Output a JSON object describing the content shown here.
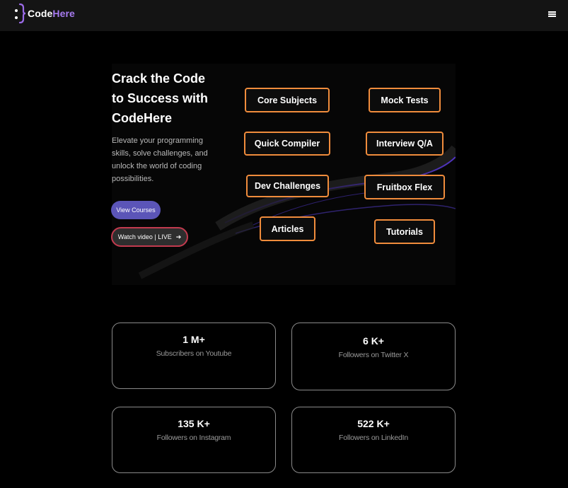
{
  "nav": {
    "logo_part1": "Code",
    "logo_part2": "Here",
    "brand_color": "#a77bf0",
    "menu_icon": "hamburger-menu-icon"
  },
  "hero": {
    "title_lines": [
      "Crack the Code",
      "to Success with",
      "CodeHere"
    ],
    "description_lines": [
      "Elevate your programming",
      "skills, solve challenges, and",
      "unlock the world of coding",
      "possibilities."
    ],
    "view_courses_label": "View Courses",
    "watch_video_label": "Watch video | LIVE",
    "watch_video_icon": "arrow-right-icon",
    "accent_color": "#f08c3c"
  },
  "tags": {
    "core_subjects": "Core Subjects",
    "mock_tests": "Mock Tests",
    "quick_compiler": "Quick Compiler",
    "interview_qa": "Interview Q/A",
    "dev_challenges": "Dev Challenges",
    "fruitbox_flex": "Fruitbox Flex",
    "articles": "Articles",
    "tutorials": "Tutorials"
  },
  "stats": [
    {
      "value": "1 M+",
      "label": "Subscribers on Youtube"
    },
    {
      "value": "6 K+",
      "label": "Followers on Twitter X"
    },
    {
      "value": "135 K+",
      "label": "Followers on Instagram"
    },
    {
      "value": "522 K+",
      "label": "Followers on LinkedIn"
    }
  ]
}
